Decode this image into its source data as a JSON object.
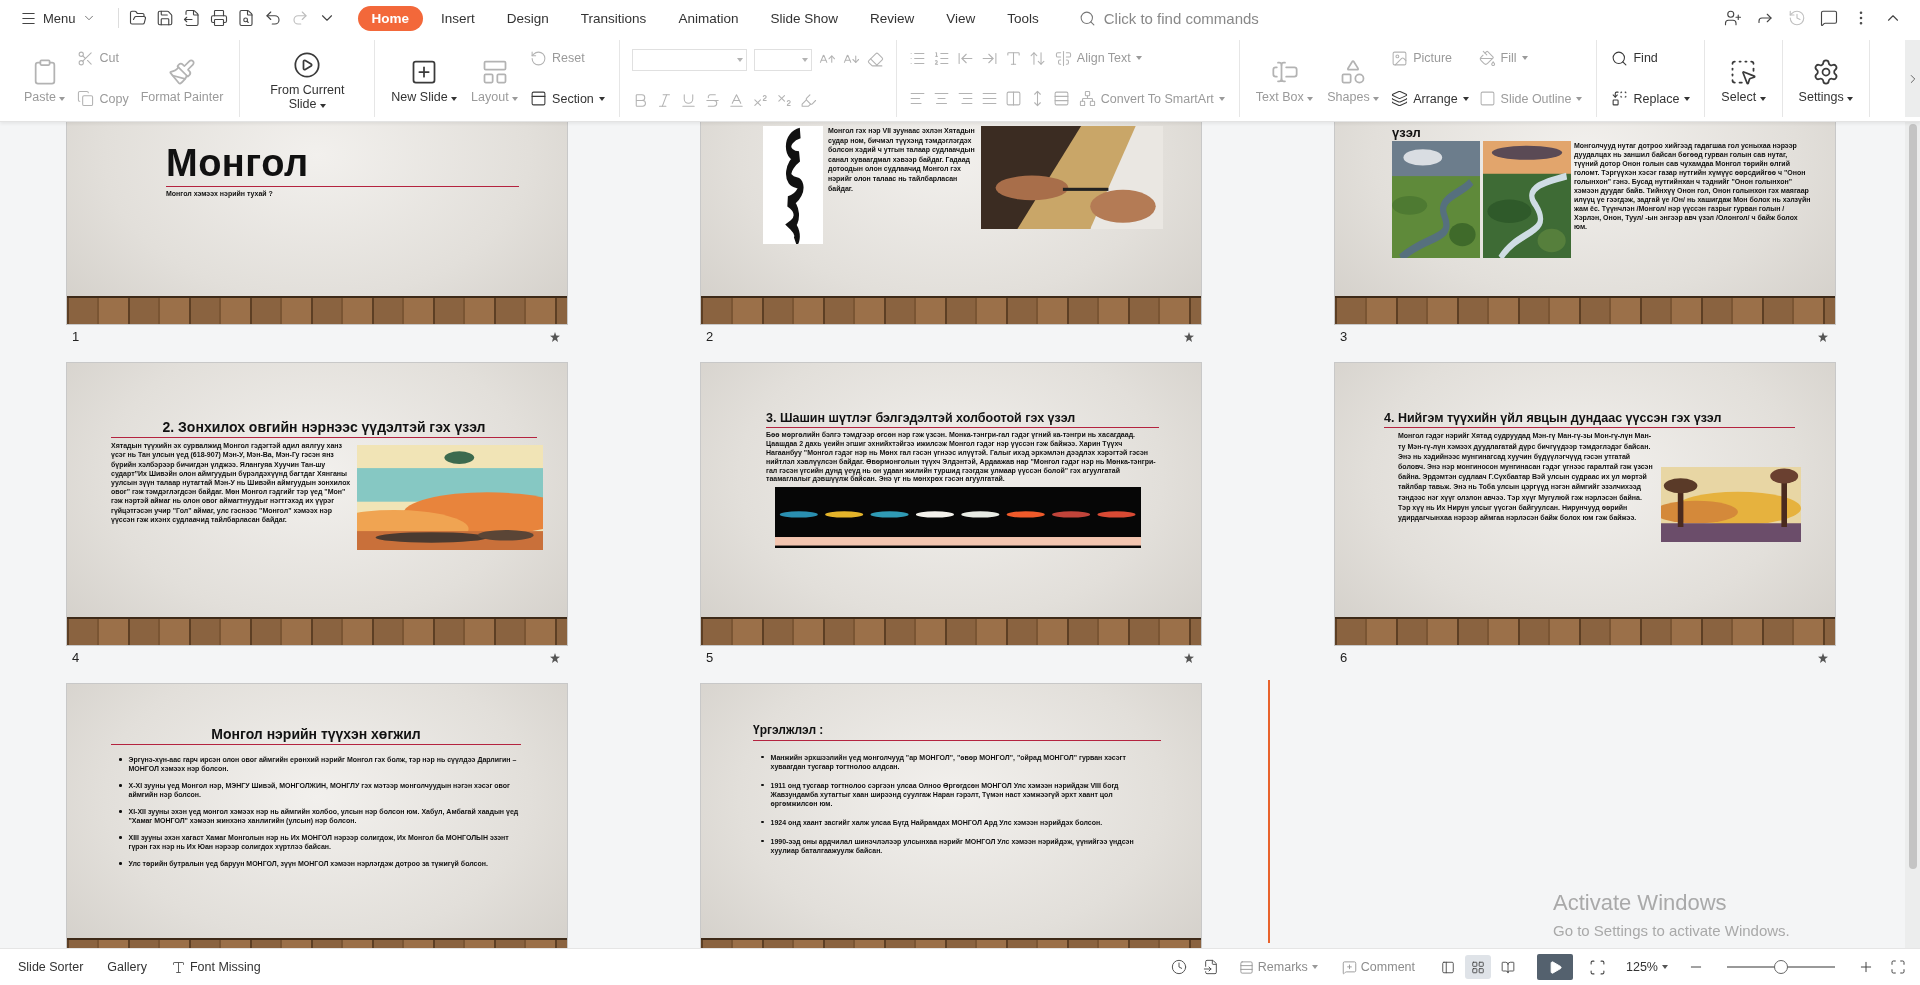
{
  "top_bar": {
    "menu_label": "Menu",
    "quick_access": [
      {
        "disabled": false
      },
      {
        "disabled": false
      },
      {
        "disabled": false
      },
      {
        "disabled": false
      },
      {
        "disabled": false
      },
      {
        "disabled": false
      },
      {
        "disabled": true
      },
      {
        "disabled": false
      }
    ],
    "tabs": [
      {
        "label": "Home",
        "selected": true
      },
      {
        "label": "Insert",
        "selected": false
      },
      {
        "label": "Design",
        "selected": false
      },
      {
        "label": "Transitions",
        "selected": false
      },
      {
        "label": "Animation",
        "selected": false
      },
      {
        "label": "Slide Show",
        "selected": false
      },
      {
        "label": "Review",
        "selected": false
      },
      {
        "label": "View",
        "selected": false
      },
      {
        "label": "Tools",
        "selected": false
      }
    ],
    "search": {
      "placeholder": "Click to find commands"
    },
    "right_icons": [
      {
        "disabled": false
      },
      {
        "disabled": false
      },
      {
        "disabled": true
      },
      {
        "disabled": false
      },
      {
        "disabled": false
      },
      {
        "disabled": false
      }
    ]
  },
  "ribbon": {
    "groups": [
      {
        "columns": [
          {
            "rows": [
              [
                {
                  "kind": "large",
                  "label": "Paste",
                  "disabled": true,
                  "caret": true
                }
              ]
            ]
          },
          {
            "rows": [
              [
                {
                  "kind": "small",
                  "label": "Cut",
                  "disabled": true
                }
              ],
              [
                {
                  "kind": "small",
                  "label": "Copy",
                  "disabled": true
                }
              ]
            ]
          },
          {
            "rows": [
              [
                {
                  "kind": "large",
                  "label": "Format Painter",
                  "disabled": true
                }
              ]
            ]
          }
        ]
      },
      {
        "columns": [
          {
            "rows": [
              [
                {
                  "kind": "large",
                  "label": "From Current Slide",
                  "disabled": false,
                  "caret": true
                }
              ]
            ]
          }
        ]
      },
      {
        "columns": [
          {
            "rows": [
              [
                {
                  "kind": "large",
                  "label": "New Slide",
                  "disabled": false,
                  "caret": true
                }
              ]
            ]
          },
          {
            "rows": [
              [
                {
                  "kind": "large",
                  "label": "Layout",
                  "disabled": true,
                  "caret": true
                }
              ]
            ]
          },
          {
            "rows": [
              [
                {
                  "kind": "small",
                  "label": "Reset",
                  "disabled": true
                }
              ],
              [
                {
                  "kind": "small",
                  "label": "Section",
                  "disabled": false,
                  "caret": true
                }
              ]
            ]
          }
        ]
      },
      {
        "columns": [
          {
            "rows": [
              [
                {
                  "kind": "field",
                  "disabled": true
                },
                {
                  "kind": "field",
                  "disabled": true
                },
                {
                  "kind": "icon",
                  "disabled": true
                },
                {
                  "kind": "icon",
                  "disabled": true
                },
                {
                  "kind": "icon",
                  "disabled": true
                }
              ],
              [
                {
                  "kind": "icon",
                  "disabled": true
                },
                {
                  "kind": "icon",
                  "disabled": true
                },
                {
                  "kind": "icon",
                  "disabled": true
                },
                {
                  "kind": "icon",
                  "disabled": true
                },
                {
                  "kind": "icon",
                  "disabled": true
                },
                {
                  "kind": "icon",
                  "disabled": true
                },
                {
                  "kind": "icon",
                  "disabled": true
                },
                {
                  "kind": "icon",
                  "disabled": true
                }
              ]
            ]
          }
        ]
      },
      {
        "columns": [
          {
            "rows": [
              [
                {
                  "kind": "icon",
                  "disabled": true
                },
                {
                  "kind": "icon",
                  "disabled": true
                },
                {
                  "kind": "icon",
                  "disabled": true
                },
                {
                  "kind": "icon",
                  "disabled": true
                },
                {
                  "kind": "icon",
                  "disabled": true
                },
                {
                  "kind": "icon",
                  "disabled": true
                },
                {
                  "kind": "small",
                  "label": "Align Text",
                  "disabled": true,
                  "caret": true
                }
              ],
              [
                {
                  "kind": "icon",
                  "disabled": true
                },
                {
                  "kind": "icon",
                  "disabled": true
                },
                {
                  "kind": "icon",
                  "disabled": true
                },
                {
                  "kind": "icon",
                  "disabled": true
                },
                {
                  "kind": "icon",
                  "disabled": true
                },
                {
                  "kind": "icon",
                  "disabled": true
                },
                {
                  "kind": "icon",
                  "disabled": true
                },
                {
                  "kind": "small",
                  "label": "Convert To SmartArt",
                  "disabled": true,
                  "caret": true
                }
              ]
            ]
          }
        ]
      },
      {
        "columns": [
          {
            "rows": [
              [
                {
                  "kind": "large",
                  "label": "Text Box",
                  "disabled": true,
                  "caret": true
                }
              ]
            ]
          },
          {
            "rows": [
              [
                {
                  "kind": "large",
                  "label": "Shapes",
                  "disabled": true,
                  "caret": true
                }
              ]
            ]
          },
          {
            "rows": [
              [
                {
                  "kind": "small",
                  "label": "Picture",
                  "disabled": true
                }
              ],
              [
                {
                  "kind": "small",
                  "label": "Arrange",
                  "disabled": false,
                  "caret": true
                }
              ]
            ]
          },
          {
            "rows": [
              [
                {
                  "kind": "small",
                  "label": "Fill",
                  "disabled": true,
                  "caret": true
                }
              ],
              [
                {
                  "kind": "small",
                  "label": "Slide Outline",
                  "disabled": true,
                  "caret": true
                }
              ]
            ]
          }
        ]
      },
      {
        "columns": [
          {
            "rows": [
              [
                {
                  "kind": "small",
                  "label": "Find",
                  "disabled": false
                }
              ],
              [
                {
                  "kind": "small",
                  "label": "Replace",
                  "disabled": false,
                  "caret": true
                }
              ]
            ]
          }
        ]
      },
      {
        "columns": [
          {
            "rows": [
              [
                {
                  "kind": "large",
                  "label": "Select",
                  "disabled": false,
                  "caret": true
                }
              ]
            ]
          }
        ]
      },
      {
        "columns": [
          {
            "rows": [
              [
                {
                  "kind": "large",
                  "label": "Settings",
                  "disabled": false,
                  "caret": true
                }
              ]
            ]
          }
        ]
      }
    ]
  },
  "slides": [
    {
      "kind": "title",
      "number": "1",
      "title": "Монгол",
      "subtitle": "Монгол хэмээх нэрийн тухай ?"
    },
    {
      "kind": "pictures-text",
      "number": "2",
      "body": "Монгол гэх нэр VII зуунаас эхлэн Хятадын судар ном, бичмэл түүхэнд тэмдэглэгдэх болсон хэдий ч утгын талаар судлаачдын санал хуваагдмал хэвээр байдаг. Гадаад дотоодын олон судлаачид Монгол гэх нэрийг олон талаас нь тайлбарласан байдаг."
    },
    {
      "kind": "title-pictures-text",
      "number": "3",
      "title": "үзэл",
      "body": "Монголчууд нутаг дотроо хийгээд гадагшаа гол усныхаа нэрээр дуудалцах нь заншил байсан бөгөөд гурван голын сав нутаг, түүний дотор Онон голын сав чухамдаа Монгол төрийн өлгий голомт. Тэргүүхэн хэсэг газар нутгийн хүмүүс өөрсдийгөө ч \"Онон голынхон\" гэнэ. Бусад нутгийнхан ч тэднийг \"Онон голынхон\" хэмээн дуудаг байв. Тийнхүү Онон гол, Онон голынхон гэх маягаар илүүц үе гээгдэж, задгай үе /Он/ нь хашигдаж Мон болох нь хэлзүйн жам ёс. Түүнчлэн /Монгол/ нэр үүссэн газрыг гурван голын /Хэрлэн, Онон, Туул/ -ын энгээр авч үзэл /Олонгол/ ч байж болох юм."
    },
    {
      "kind": "heading-text-picture",
      "number": "4",
      "title": "2. Зонхилох овгийн нэрнээс үүдэлтэй гэх үзэл",
      "body": "Хятадын түүхийн эх сурвалжид Монгол гэдэгтэй адил аялгуу ханз үсэг нь Тан улсын үед (618-907) Мэн-У, Мэн-Ва, Мэн-Гу гэсэн янз бүрийн хэлбэрээр бичигдэн үлджээ. Ялангуяа Хуучин Тан-шу судартˮИх Шивэйн олон аймгуудын бүрэлдэхүүнд багтдаг Хянганы уулсын зүүн талаар нутагтай Мэн-У нь Шивэйн аймгуудын зонхилох овог\" гэж тэмдэглэгдсэн байдаг. Мөн Монгол гэдгийг тэр үед \"Мон\" гэж нэртэй аймаг нь олон овог аймагтнуудыг нэгтгэхэд их үүрэг гүйцэтгэсэн учир \"Гол\" аймаг, улс гэснээс \"Монгол\" хэмээх нэр үүссэн гэж ихэнх судлаачид тайлбарласан байдаг."
    },
    {
      "kind": "heading-text-strip",
      "number": "5",
      "title": "3. Шашин шүтлэг бэлгэдэлтэй холбоотой гэх үзэл",
      "body": "Бөө мөргөлийн бэлгэ тэмдгээр өгсөн нэр гэж үзсэн. Монка-тэнгри-гал гэдэг үгний ка-тэнгри нь хасагдаад. Цаашдаа 2 дахь үеийн эгшиг эхнийхтэйгээ ижилсэж Монгол гэдэг нэр үүссэн гэж байжээ. Харин Түүхч Нагаанбуу \"Монгол гэдэг нэр нь Мөнх гал гэсэн үгнээс илүүтэй. Галыг ихэд эрхэмлэн дээдлэх хэрэгтэй гэсэн нийтлэл хэвлүүлсэн байдаг. Өвөрмонголын түүхч Элдэнтэй, Ардаажав нар \"Монгол гэдэг нэр нь Мөнка-тэнгри-гал гэсэн үгсийн дунд үеүд нь он удаан жилийн туршид гээгдэж улмаар үүссэн болой\" гэх агуулгатай таамаглалыг дэвшүүлж байсан. Энэ үг нь мөнхрөх гэсэн агуулгатай."
    },
    {
      "kind": "heading-text-picture",
      "number": "6",
      "title": "4. Нийгэм түүхийн үйл явцын дундаас үүссэн гэх үзэл",
      "body": "Монгол гэдэг нэрийг Хятад судруудад Мэн-гү Ман-гү-зы Мон-гү-лүн Ман-ту Мэн-гү-лүн хэмээх дуудлагатай дүрс бичгүүдээр тэмдэглэдэг байсан. Энэ нь хэдийнээс мунгинагсад хуучин бүдүүлэгчүүд гэсэн утгатай боловч. Энэ нэр монгиносон мунгинасан гэдэг үгнээс гаралтай гэж үзсэн байна. Эрдэмтэн судлаач Г.Сүхбаатар Вэй улсын судраас их ул мөртэй тайлбар тавьж. Энэ нь Тоба улсын цэргүүд нэгэн аймгийг эзэлчихээд тэндээс нэг хүүг олзлон авчээ. Тэр хүүг Мугулюй гэж нэрлэсэн байна. Тэр хүү нь Их Нирун улсыг үүсгэн байгуулсан. Нирунчууд өөрийн удирдагчынхаа нэрээр аймгаа нэрлэсэн байж болох юм гэж байжээ."
    },
    {
      "kind": "heading-bullets",
      "title": "Монгол нэрийн түүхэн хөгжил",
      "bullets": [
        "Эргүнэ-хүн-аас гарч ирсэн олон овог аймгийн ерөнхий нэрийг Монгол гэх болж, тэр нэр нь сүүлдээ Дарлигин – МОНГОЛ хэмээх нэр болсон.",
        "X-XI зууны үед Монгол нэр, МЭНГУ Шивэй, МОНГОЛЖИН, МОНГЛУ гэх мэтээр монголчуудын нэгэн хэсэг овог аймгийн нэр болсон.",
        "XI-XII зууны эхэн үед монгол хэмээх нэр нь аймгийн холбоо, улсын нэр болсон юм. Хабул, Амбагай хаадын үед \"Хамаг МОНГОЛ\" хэмээн жинхэнэ ханлигийн (улсын) нэр болсон.",
        "XIII зууны эхэн хагаст Хамаг Монголын нэр нь Их МОНГОЛ нэрээр солигдож, Их Монгол ба МОНГОЛЫН эзэнт гүрэн гэх нэр нь Их Юан нэрээр солигдох хүртлээ байсан.",
        "Улс төрийн бутралын үед баруун МОНГОЛ, зүүн МОНГОЛ хэмээн нэрлэгдэж дотроо за түжигүй болсон."
      ]
    },
    {
      "kind": "left-heading-bullets",
      "title": "Үргэлжлэл :",
      "bullets": [
        "Манжийн эрхшээлийн үед монголчууд \"ар МОНГОЛ\", \"өвөр МОНГОЛ\", \"ойрад МОНГОЛ\" гурван хэсэгт хуваагдан тусгаар тогтнолоо алдсан.",
        "1911 онд тусгаар тогтнолоо сэргээн улсаа Олноо Өргөгдсөн МОНГОЛ Улс хэмээн нэрийдэж VIII богд Жавзундамба хутагтыг хаан ширээнд суулгаж Наран гэрэлт, Түмэн наст хэмжээгүй эрхт хаант цол өргөмжилсөн юм.",
        "1924 онд хаант засгийг халж улсаа Бүгд Найрамдах МОНГОЛ Ард Улс хэмээн нэрийдэх болсон.",
        "1990-ээд оны ардчилал шинэчлэлээр улсынхаа нэрийг МОНГОЛ Улс хэмээн нэрийдэж, үүнийгээ үндсэн хуулиар баталгаажуулж байсан."
      ]
    }
  ],
  "insertion_marker": true,
  "os_notice": {
    "title": "Activate Windows",
    "subtitle": "Go to Settings to activate Windows."
  },
  "status_bar": {
    "left": [
      {
        "kind": "text",
        "label": "Slide Sorter"
      },
      {
        "kind": "text",
        "label": "Gallery"
      },
      {
        "kind": "warning",
        "label": "Font Missing"
      }
    ],
    "remarks": {
      "label": "Remarks"
    },
    "comment": {
      "label": "Comment"
    },
    "views": [
      {
        "selected": false
      },
      {
        "selected": true
      },
      {
        "selected": false
      }
    ],
    "zoom": {
      "value": "125%",
      "level": 0.5
    }
  }
}
